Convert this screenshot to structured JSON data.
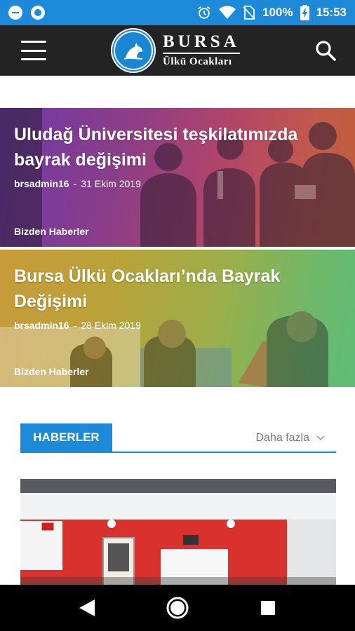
{
  "status_bar": {
    "battery": "100%",
    "time": "15:53",
    "icons": [
      "minus-circle-icon",
      "record-circle-icon",
      "alarm-icon",
      "wifi-icon",
      "no-sim-icon",
      "battery-charging-icon"
    ]
  },
  "app_bar": {
    "menu_icon": "hamburger-menu-icon",
    "logo_title": "BURSA",
    "logo_subtitle": "Ülkü Ocakları",
    "search_icon": "search-icon"
  },
  "featured": [
    {
      "title": "Uludağ Üniversitesi teşkilatımızda bayrak değişimi",
      "author": "brsadmin16",
      "separator": "-",
      "date": "31 Ekim 2019",
      "category": "Bizden Haberler"
    },
    {
      "title": "Bursa Ülkü Ocakları’nda Bayrak Değişimi",
      "author": "brsadmin16",
      "separator": "-",
      "date": "28 Ekim 2019",
      "category": "Bizden Haberler"
    }
  ],
  "news_section": {
    "tab_label": "HABERLER",
    "more_label": "Daha fazla"
  },
  "colors": {
    "accent": "#1c8ad8",
    "app_bar": "#232323",
    "nav_bar": "#000000"
  },
  "nav_bar": {
    "icons": [
      "back-icon",
      "home-icon",
      "recents-icon"
    ]
  }
}
